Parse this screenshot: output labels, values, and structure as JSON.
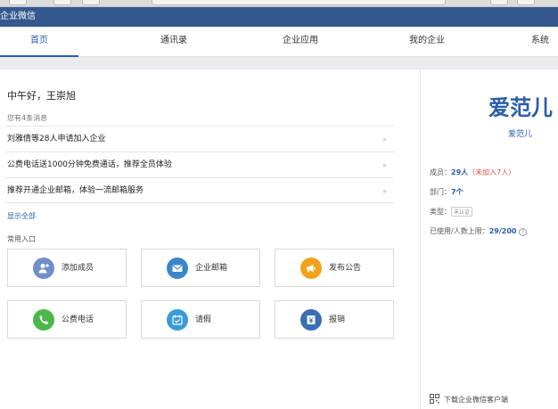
{
  "window": {
    "title": "企业微信"
  },
  "nav": {
    "tabs": [
      {
        "label": "首页",
        "active": true
      },
      {
        "label": "通讯录",
        "active": false
      },
      {
        "label": "企业应用",
        "active": false
      },
      {
        "label": "我的企业",
        "active": false
      },
      {
        "label": "系统",
        "active": false
      }
    ]
  },
  "home": {
    "greeting": "中午好，王崇旭",
    "message_count": "您有4条消息",
    "messages": [
      {
        "text": "刘雅倩等28人申请加入企业",
        "arrow": "»"
      },
      {
        "text": "公费电话送1000分钟免费通话，推荐全员体验",
        "arrow": "»"
      },
      {
        "text": "推荐开通企业邮箱，体验一流邮箱服务",
        "arrow": "»"
      }
    ],
    "show_all": "显示全部",
    "shortcuts_title": "常用入口",
    "shortcuts": [
      {
        "label": "添加成员",
        "icon": "add-member-icon",
        "color": "#6f8fc6"
      },
      {
        "label": "企业邮箱",
        "icon": "mail-icon",
        "color": "#3a86c8"
      },
      {
        "label": "发布公告",
        "icon": "megaphone-icon",
        "color": "#f0a21b"
      },
      {
        "label": "公费电话",
        "icon": "phone-icon",
        "color": "#4cb84a"
      },
      {
        "label": "请假",
        "icon": "calendar-icon",
        "color": "#3a9bd6"
      },
      {
        "label": "报销",
        "icon": "yen-icon",
        "color": "#3a6fb4"
      }
    ]
  },
  "company": {
    "name": "爱范儿",
    "sub": "爱范儿",
    "members_label": "成员：",
    "members_value": "29人",
    "members_pending": "（未加入7人）",
    "departments_label": "部门：",
    "departments_value": "7个",
    "type_label": "类型：",
    "type_badge": "未认证",
    "quota_label": "已使用/人数上限：",
    "quota_value": "29/200",
    "help_glyph": "?",
    "download": "下载企业微信客户端"
  },
  "colors": {
    "accent": "#2a5ea8",
    "titlebar": "#33588e",
    "warning": "#d9534f"
  }
}
